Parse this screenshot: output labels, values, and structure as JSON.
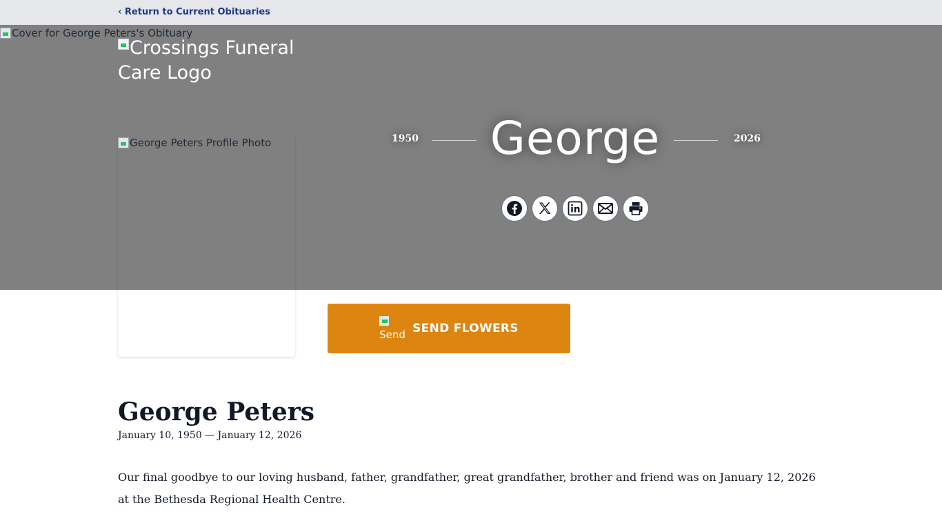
{
  "topbar": {
    "return_label": "‹ Return to Current Obituaries"
  },
  "cover": {
    "alt": "Cover for George Peters's Obituary"
  },
  "logo": {
    "alt": "Crossings Funeral Care Logo"
  },
  "profile": {
    "alt": "George Peters Profile Photo"
  },
  "header": {
    "birth_year": "1950",
    "death_year": "2026",
    "first_name": "George"
  },
  "share": {
    "icons": [
      "facebook-icon",
      "x-icon",
      "linkedin-icon",
      "email-icon",
      "print-icon"
    ]
  },
  "flowers": {
    "icon_alt": "Send",
    "label": "SEND FLOWERS",
    "color": "#dd8511"
  },
  "obituary": {
    "name": "George Peters",
    "dates": "January 10, 1950 — January 12, 2026",
    "text": "Our final goodbye to our loving husband, father, grandfather, great grandfather, brother and friend was on January 12, 2026 at the Bethesda Regional Health Centre."
  },
  "colors": {
    "topbar": "#e5e7eb",
    "cover": "#808080",
    "link": "#1e3a8a",
    "text": "#111827"
  }
}
